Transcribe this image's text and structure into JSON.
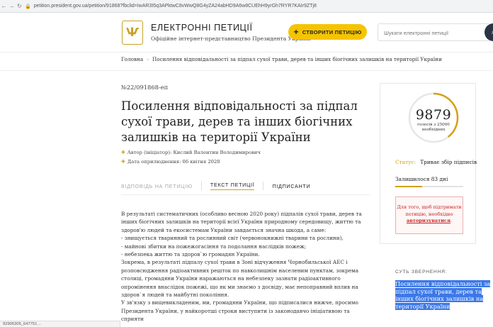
{
  "browser": {
    "url": "petition.president.gov.ua/petition/91868?fbclid=IwAR3I5q3APktwC8vWwQ8G4yZA24abHD9A6w8CUEhH9yrGh7RYR7KAIr9ZTj8"
  },
  "header": {
    "site_title": "ЕЛЕКТРОННІ ПЕТИЦІЇ",
    "site_subtitle": "Офіційне інтернет-представництво Президента України",
    "create_button": "СТВОРИТИ ПЕТИЦІЮ",
    "search_placeholder": "Шукати електронні петиції"
  },
  "breadcrumb": {
    "home": "Головна",
    "current": "Посилення відповідальності за підпал сухої трави, дерев та інших біогічних залишків на території України"
  },
  "petition": {
    "number": "№22/091868-еп",
    "title": "Посилення відповідальності за підпал сухої трави, дерев та інших біогічних залишків на території України",
    "author": "Автор (ініціатор): Кислий Валентин Володимирович",
    "date": "Дата оприлюднення: 06 квітня 2020"
  },
  "tabs": [
    {
      "label": "ВІДПОВІДЬ НА ПЕТИЦІЮ",
      "active": false
    },
    {
      "label": "ТЕКСТ ПЕТИЦІЇ",
      "active": true
    },
    {
      "label": "ПІДПИСАНТИ",
      "active": false
    }
  ],
  "body": {
    "p1": "В результаті систематичних (особливо весною 2020 року) підпалів сухої трави, дерев та інших біогічних залишків на території всієї України природному середовищу, життю та здоров'ю людей та екосистемам України завдається значна шкода, а саме:\n- знищується тваринний та рослинний світ (червонокнижні тварини та рослини),\n- майнові збитки на пожежогасіння та подолання наслідків пожеж;\n- небезпека життю та здоров`ю громадян України.",
    "p2": "Зокрема, в результаті підпалу сухої трави в Зоні відчуження Чорнобильської АЕС і розповсюдження радіоактивних решток по навколишнім населеним пунктам, зокрема столиці, громадяни України наражаються на небезпеку зазнати радіоактивного опромінення внаслідок пожежі, що як ми знаємо з досвіду, має непоправний вплив на здоров`я людей та майбутні покоління.",
    "p3": "У зв'язку з вищевикладеним, ми, громадяни України, що підписалися нижче, просимо Президента України, у найкоротші строки виступити із законодавчо ініціативою та сприяти"
  },
  "stats": {
    "count": "9879",
    "caption": "голосів з 25000 необхідних",
    "progress_fraction": 0.395,
    "status_label": "Статус:",
    "status_value": "Триває збір підписів",
    "remaining": "Залишилося 83 дні",
    "auth_text": "Для того, щоб підтримати петицію, необхідно",
    "auth_link": "авторизуватися",
    "auth_end": "."
  },
  "essence": {
    "label": "СУТЬ ЗВЕРНЕННЯ:",
    "text": "Посилення відповідальності за підпал сухої трави, дерев та інших біогічних залишків на території України"
  },
  "status_bar": {
    "text": "92905305_647751…"
  },
  "colors": {
    "accent": "#d4a017",
    "button": "#f5c400",
    "selection": "#3b78e7",
    "error": "#c32020"
  }
}
